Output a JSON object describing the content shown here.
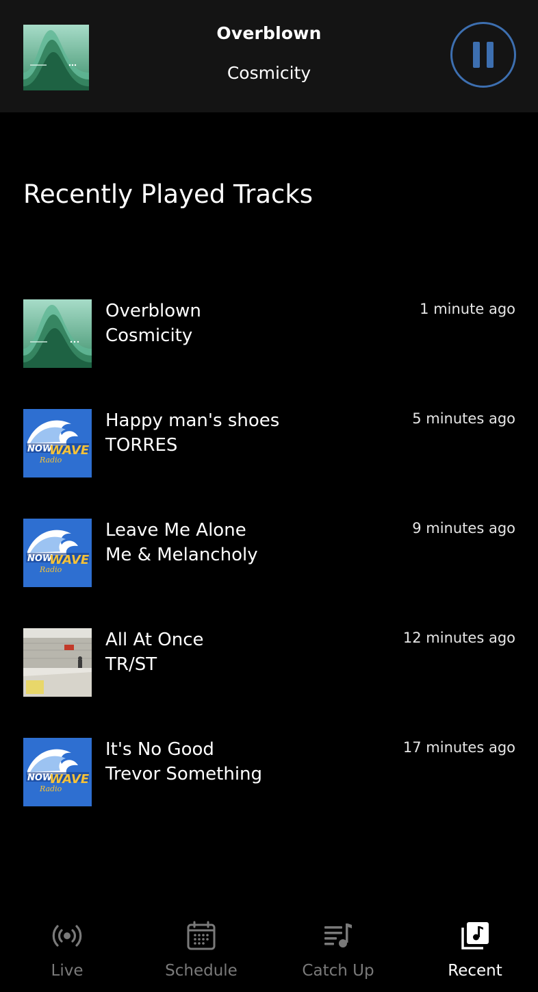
{
  "now_playing": {
    "title": "Overblown",
    "artist": "Cosmicity",
    "control_icon": "pause-icon",
    "accent_color": "#3d6fb0"
  },
  "section_title": "Recently Played Tracks",
  "tracks": [
    {
      "title": "Overblown",
      "artist": "Cosmicity",
      "time": "1 minute ago",
      "art": "green-wave-art"
    },
    {
      "title": "Happy man's shoes",
      "artist": "TORRES",
      "time": "5 minutes ago",
      "art": "now-wave-radio-logo"
    },
    {
      "title": "Leave Me Alone",
      "artist": "Me & Melancholy",
      "time": "9 minutes ago",
      "art": "now-wave-radio-logo"
    },
    {
      "title": "All At Once",
      "artist": "TR/ST",
      "time": "12 minutes ago",
      "art": "snow-photo-art"
    },
    {
      "title": "It's No Good",
      "artist": "Trevor Something",
      "time": "17 minutes ago",
      "art": "now-wave-radio-logo"
    }
  ],
  "nav": [
    {
      "label": "Live",
      "icon": "broadcast-icon",
      "active": false
    },
    {
      "label": "Schedule",
      "icon": "calendar-icon",
      "active": false
    },
    {
      "label": "Catch Up",
      "icon": "playlist-icon",
      "active": false
    },
    {
      "label": "Recent",
      "icon": "music-library-icon",
      "active": true
    }
  ],
  "colors": {
    "background": "#000000",
    "header_bg": "#141414",
    "inactive_nav": "#7a7a7a",
    "active_nav": "#ffffff"
  }
}
